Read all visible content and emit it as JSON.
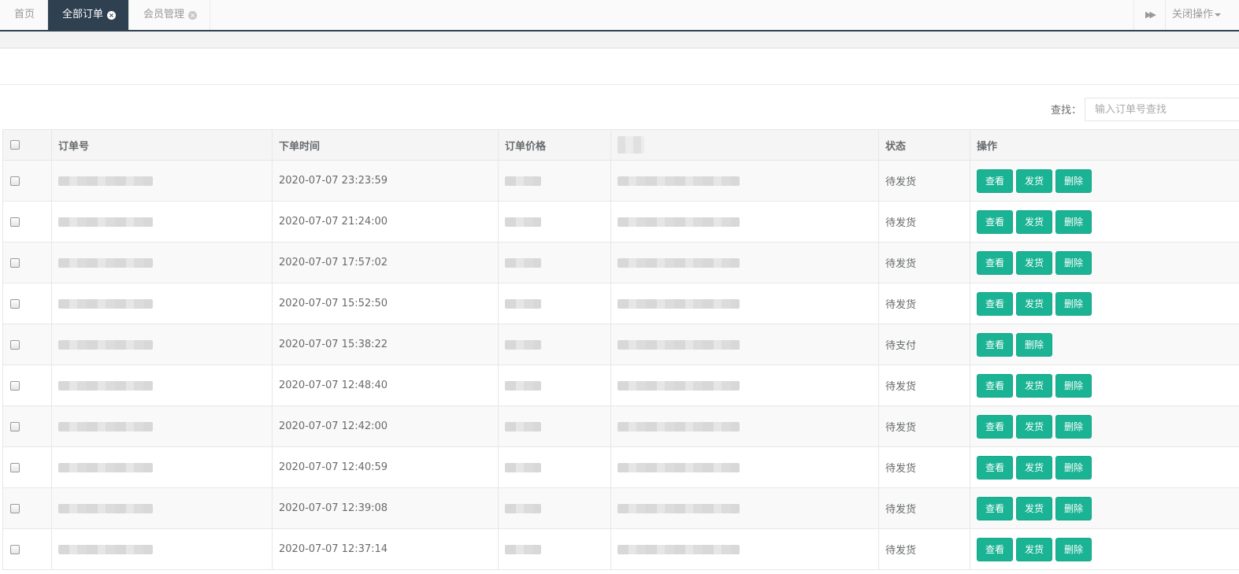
{
  "tabs": {
    "items": [
      {
        "label": "首页",
        "active": false,
        "closable": false
      },
      {
        "label": "全部订单",
        "active": true,
        "closable": true
      },
      {
        "label": "会员管理",
        "active": false,
        "closable": true
      }
    ],
    "close_ops_label": "关闭操作"
  },
  "search": {
    "label": "查找：",
    "placeholder": "输入订单号查找"
  },
  "table": {
    "headers": [
      "订单号",
      "下单时间",
      "订单价格",
      "状态",
      "操作"
    ],
    "rows": [
      {
        "time": "2020-07-07 23:23:59",
        "status": "待发货",
        "actions": [
          "查看",
          "发货",
          "删除"
        ]
      },
      {
        "time": "2020-07-07 21:24:00",
        "status": "待发货",
        "actions": [
          "查看",
          "发货",
          "删除"
        ]
      },
      {
        "time": "2020-07-07 17:57:02",
        "status": "待发货",
        "actions": [
          "查看",
          "发货",
          "删除"
        ]
      },
      {
        "time": "2020-07-07 15:52:50",
        "status": "待发货",
        "actions": [
          "查看",
          "发货",
          "删除"
        ]
      },
      {
        "time": "2020-07-07 15:38:22",
        "status": "待支付",
        "actions": [
          "查看",
          "删除"
        ]
      },
      {
        "time": "2020-07-07 12:48:40",
        "status": "待发货",
        "actions": [
          "查看",
          "发货",
          "删除"
        ]
      },
      {
        "time": "2020-07-07 12:42:00",
        "status": "待发货",
        "actions": [
          "查看",
          "发货",
          "删除"
        ]
      },
      {
        "time": "2020-07-07 12:40:59",
        "status": "待发货",
        "actions": [
          "查看",
          "发货",
          "删除"
        ]
      },
      {
        "time": "2020-07-07 12:39:08",
        "status": "待发货",
        "actions": [
          "查看",
          "发货",
          "删除"
        ]
      },
      {
        "time": "2020-07-07 12:37:14",
        "status": "待发货",
        "actions": [
          "查看",
          "发货",
          "删除"
        ]
      }
    ]
  },
  "colors": {
    "accent": "#1ab394",
    "active_tab_bg": "#2f4050"
  },
  "icons": {
    "tab_close": "close-circle-icon",
    "forward": "double-chevron-right-icon",
    "dropdown": "caret-down-icon"
  }
}
